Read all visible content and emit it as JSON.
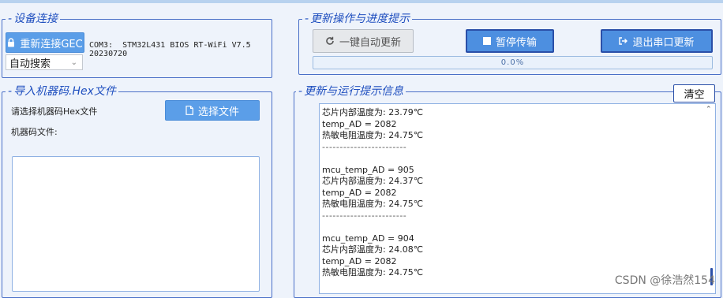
{
  "device_group": {
    "legend": "设备连接",
    "reconnect_button": "重新连接GEC",
    "device_line1": "COM3:  STM32L431 BIOS RT-WiFi V7.5",
    "device_line2": "20230720",
    "search_select": "自动搜索"
  },
  "update_group": {
    "legend": "更新操作与进度提示",
    "auto_update_button": "一键自动更新",
    "pause_button": "暂停传输",
    "exit_serial_button": "退出串口更新",
    "progress_text": "0.0%",
    "progress_value": 0.0
  },
  "hex_group": {
    "legend": "导入机器码.Hex文件",
    "prompt": "请选择机器码Hex文件",
    "select_file_button": "选择文件",
    "file_label": "机器码文件:"
  },
  "log_group": {
    "legend": "更新与运行提示信息",
    "clear_button": "清空",
    "lines": [
      "芯片内部温度为: 23.79℃",
      "temp_AD = 2082",
      "热敏电阻温度为: 24.75℃",
      "------------------------",
      "",
      "mcu_temp_AD = 905",
      "芯片内部温度为: 24.37℃",
      "temp_AD = 2082",
      "热敏电阻温度为: 24.75℃",
      "------------------------",
      "",
      "mcu_temp_AD = 904",
      "芯片内部温度为: 24.08℃",
      "temp_AD = 2082",
      "热敏电阻温度为: 24.75℃"
    ]
  },
  "watermark": "CSDN @徐浩然154",
  "colors": {
    "accent": "#1f4fbf",
    "button_blue": "#5b9ee8",
    "border_blue": "#4a6fc7",
    "background": "#eef3fb"
  }
}
